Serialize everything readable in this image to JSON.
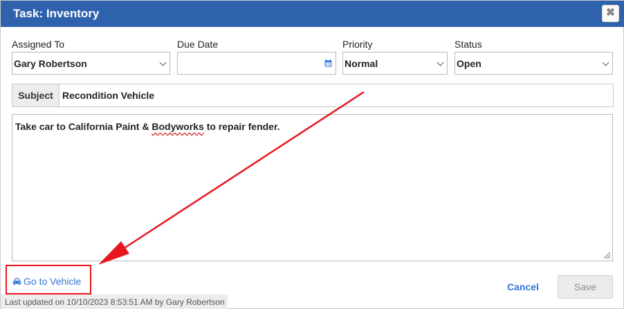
{
  "dialog": {
    "title": "Task: Inventory",
    "close_symbol": "✖"
  },
  "form": {
    "assigned_to": {
      "label": "Assigned To",
      "value": "Gary Robertson"
    },
    "due_date": {
      "label": "Due Date",
      "value": ""
    },
    "priority": {
      "label": "Priority",
      "value": "Normal"
    },
    "status": {
      "label": "Status",
      "value": "Open"
    },
    "subject": {
      "label": "Subject",
      "value": "Recondition Vehicle"
    },
    "notes": {
      "before": "Take car to California Paint & ",
      "misspelled": "Bodyworks",
      "after": " to repair fender."
    }
  },
  "actions": {
    "go_to_vehicle": "Go to Vehicle",
    "cancel": "Cancel",
    "save": "Save"
  },
  "footer": {
    "last_updated": "Last updated on 10/10/2023 8:53:51 AM by Gary Robertson"
  },
  "icons": {
    "close": "close-icon",
    "calendar": "calendar-icon",
    "car": "car-icon",
    "chevron": "chevron-down-icon"
  },
  "colors": {
    "titlebar": "#2f62ad",
    "link": "#2f75d6",
    "annotation": "#e8161c"
  }
}
